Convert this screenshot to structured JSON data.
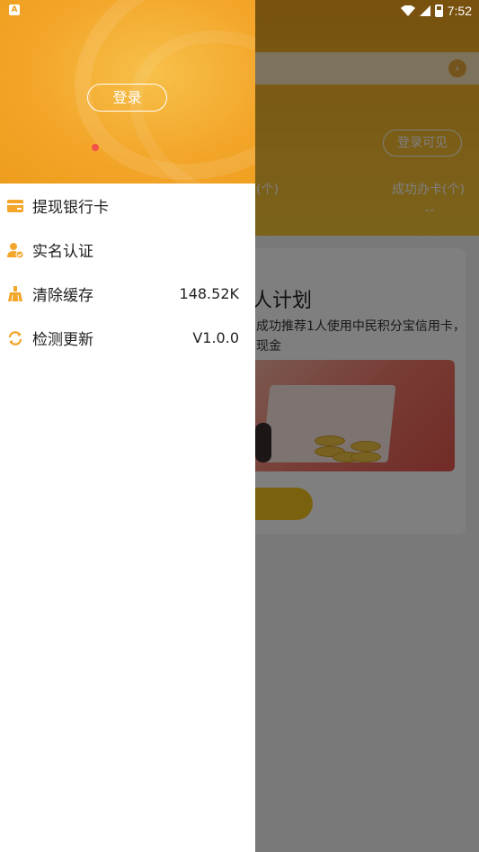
{
  "status_bar": {
    "time": "7:52",
    "left_icon": "A"
  },
  "background": {
    "login_visible": "登录可见",
    "label_left": "(个)",
    "label_right": "成功办卡(个)",
    "value_right": "--",
    "card_title": "人计划",
    "card_desc_line1": "成功推荐1人使用中民积分宝信用卡，",
    "card_desc_line2": "现金"
  },
  "drawer": {
    "login_label": "登录",
    "menu": [
      {
        "label": "提现银行卡",
        "value": "",
        "icon": "bank-card-icon"
      },
      {
        "label": "实名认证",
        "value": "",
        "icon": "verified-user-icon"
      },
      {
        "label": "清除缓存",
        "value": "148.52K",
        "icon": "broom-icon"
      },
      {
        "label": "检测更新",
        "value": "V1.0.0",
        "icon": "refresh-icon",
        "badge": true
      }
    ]
  },
  "colors": {
    "accent": "#f3a62a",
    "badge": "#f2524a"
  }
}
